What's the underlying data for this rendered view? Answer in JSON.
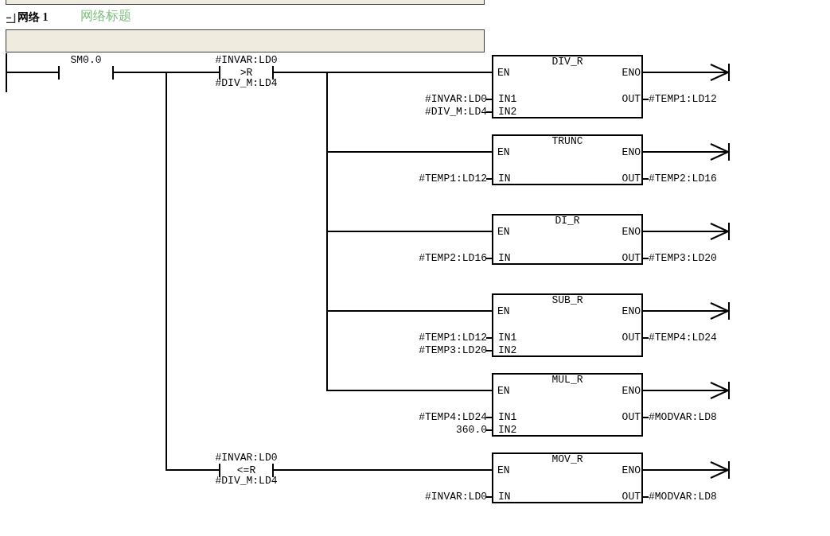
{
  "network": {
    "label": "网络 1",
    "title": "网络标题"
  },
  "rung": {
    "contact": {
      "kind": "normally_open",
      "operand": "SM0.0"
    },
    "branches": [
      {
        "contact": {
          "kind": "compare",
          "operand_top": "#INVAR:LD0",
          "operator": ">R",
          "operand_bottom": "#DIV_M:LD4"
        },
        "boxes": [
          {
            "title": "DIV_R",
            "enable_in": "EN",
            "enable_out": "ENO",
            "inputs": [
              {
                "pin": "IN1",
                "operand": "#INVAR:LD0"
              },
              {
                "pin": "IN2",
                "operand": "#DIV_M:LD4"
              }
            ],
            "output": {
              "pin": "OUT",
              "operand": "#TEMP1:LD12"
            }
          },
          {
            "title": "TRUNC",
            "enable_in": "EN",
            "enable_out": "ENO",
            "inputs": [
              {
                "pin": "IN",
                "operand": "#TEMP1:LD12"
              }
            ],
            "output": {
              "pin": "OUT",
              "operand": "#TEMP2:LD16"
            }
          },
          {
            "title": "DI_R",
            "enable_in": "EN",
            "enable_out": "ENO",
            "inputs": [
              {
                "pin": "IN",
                "operand": "#TEMP2:LD16"
              }
            ],
            "output": {
              "pin": "OUT",
              "operand": "#TEMP3:LD20"
            }
          },
          {
            "title": "SUB_R",
            "enable_in": "EN",
            "enable_out": "ENO",
            "inputs": [
              {
                "pin": "IN1",
                "operand": "#TEMP1:LD12"
              },
              {
                "pin": "IN2",
                "operand": "#TEMP3:LD20"
              }
            ],
            "output": {
              "pin": "OUT",
              "operand": "#TEMP4:LD24"
            }
          },
          {
            "title": "MUL_R",
            "enable_in": "EN",
            "enable_out": "ENO",
            "inputs": [
              {
                "pin": "IN1",
                "operand": "#TEMP4:LD24"
              },
              {
                "pin": "IN2",
                "operand": "360.0"
              }
            ],
            "output": {
              "pin": "OUT",
              "operand": "#MODVAR:LD8"
            }
          }
        ]
      },
      {
        "contact": {
          "kind": "compare",
          "operand_top": "#INVAR:LD0",
          "operator": "<=R",
          "operand_bottom": "#DIV_M:LD4"
        },
        "boxes": [
          {
            "title": "MOV_R",
            "enable_in": "EN",
            "enable_out": "ENO",
            "inputs": [
              {
                "pin": "IN",
                "operand": "#INVAR:LD0"
              }
            ],
            "output": {
              "pin": "OUT",
              "operand": "#MODVAR:LD8"
            }
          }
        ]
      }
    ]
  }
}
